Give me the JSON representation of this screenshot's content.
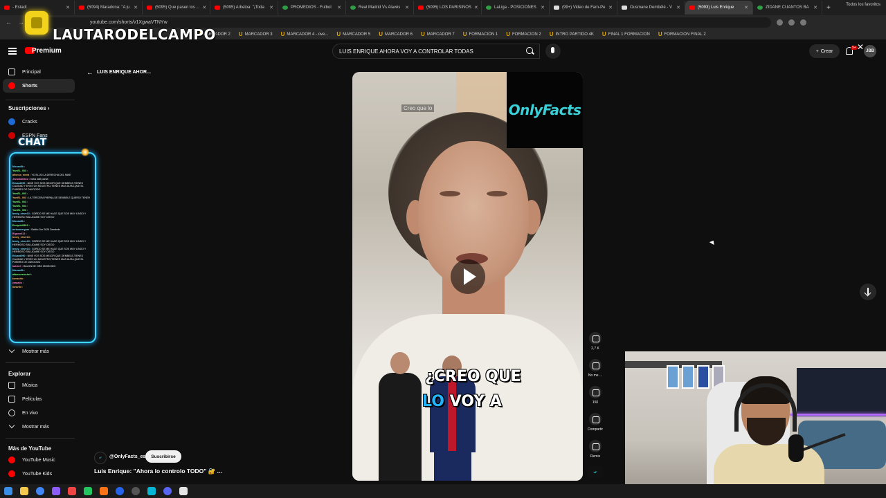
{
  "browser": {
    "tabs": [
      {
        "label": "- Estadí",
        "icon": "youtube-icon"
      },
      {
        "label": "(5094) Maradona: \"A ju",
        "icon": "youtube-icon"
      },
      {
        "label": "(5095) Que pasen los ...",
        "icon": "youtube-icon"
      },
      {
        "label": "(5095) Arbeloa: \"¡Toda",
        "icon": "youtube-icon"
      },
      {
        "label": "PROMEDIOS - Futbol",
        "icon": "green-icon"
      },
      {
        "label": "Real Madrid Vs Alavés",
        "icon": "green-icon"
      },
      {
        "label": "(5095) LOS PARISINOS",
        "icon": "youtube-icon"
      },
      {
        "label": "LaLiga - POSICIONES",
        "icon": "green-icon"
      },
      {
        "label": "(99+) Video de Fam-Pe",
        "icon": "tiktok-icon"
      },
      {
        "label": "Ousmane Dembélé - V",
        "icon": "wiki-icon"
      },
      {
        "label": "(5093) Luis Enrique",
        "icon": "youtube-icon",
        "active": true
      },
      {
        "label": "ZIDANE CUANTOS BA",
        "icon": "green-icon"
      }
    ],
    "url": "youtube.com/shorts/v1XgwaVTNYw",
    "bookmarks": [
      "MARCADOR 2",
      "MARCADOR 3",
      "MARCADOR 4 - ove...",
      "MARCADOR 5",
      "MARCADOR 6",
      "MARCADOR 7",
      "FORMACION 1",
      "FORMACION 2",
      "INTRO PARTIDO 4K",
      "FINAL 1 FORMACION",
      "FORMACION FINAL 2"
    ],
    "bookmarks_all": "Todos los favoritos"
  },
  "overlay": {
    "streamer_name": "LAUTARODELCAMPO",
    "chat_label": "CHAT",
    "chat": [
      {
        "user": "Nicoso5k :",
        "msg": "",
        "c": ""
      },
      {
        "user": "YamEL_003 :",
        "msg": "",
        "c": "g"
      },
      {
        "user": "alfonso_mvvb :",
        "msg": "YO ELIJO LA DERECHA DEL NINE",
        "c": "o"
      },
      {
        "user": "Jezuskariano :",
        "msg": "haha wait parria",
        "c": "p"
      },
      {
        "user": "Eduard090 :",
        "msg": "NINE VOS SOS MEJOR QUE DEMBELE,TIENES CALIDAD Y ERES UN MOUSTRO,TIENES MAS AURA,QUE EL PUEBRO DE DAVOODO",
        "c": ""
      },
      {
        "user": "YamEL_003 :",
        "msg": "",
        "c": "g"
      },
      {
        "user": "YamEL_003 :",
        "msg": "LA TERCERA PIERNA DE DEMBELE QUIERO TENER",
        "c": "o"
      },
      {
        "user": "YamEL_003 :",
        "msg": "",
        "c": "g"
      },
      {
        "user": "YamEL_003 :",
        "msg": "",
        "c": "g"
      },
      {
        "user": "YamEL_003 :",
        "msg": "",
        "c": "g"
      },
      {
        "user": "beuty_nieve13 :",
        "msg": "GORDO SE ME HACE QUE SOS MUY LINDO Y HERMOSO SALUDAME SOY CIEGO",
        "c": ""
      },
      {
        "user": "Nicoso5k :",
        "msg": "",
        "c": ""
      },
      {
        "user": "Ezequiel0810 :",
        "msg": "",
        "c": "g"
      },
      {
        "user": "mrbooneryyer :",
        "msg": "Ballón Dor 2026 Dembele",
        "c": ""
      },
      {
        "user": "Bigooo412 :",
        "msg": "",
        "c": "p"
      },
      {
        "user": "beuty_nieve13 :",
        "msg": "",
        "c": "o"
      },
      {
        "user": "beuty_nieve13 :",
        "msg": "GORDO SE ME HACE QUE SOS MUY LINDO Y HERMOSO SALUDAME SOY CIEGO",
        "c": ""
      },
      {
        "user": "beuty_nieve13 :",
        "msg": "GORDO SE ME HACE QUE SOS MUY LINDO Y HERMOSO SALUDAME SOY CIEGO",
        "c": ""
      },
      {
        "user": "Eduard090 :",
        "msg": "NINE VOS SOS MEJOR QUE DEMBELE,TIENES CALIDAD Y ERES UN MOUSTRO,TIENES MAS AURA,QUE EL PUEBRO DE DAVOODO",
        "c": ""
      },
      {
        "user": "kalvinX :",
        "msg": "BALON DE ORO MOISCIDO",
        "c": "p"
      },
      {
        "user": "Nicoso5k :",
        "msg": "",
        "c": ""
      },
      {
        "user": "albanoesmchef :",
        "msg": "",
        "c": "g"
      },
      {
        "user": "tomacito :",
        "msg": "",
        "c": "o"
      },
      {
        "user": "zarpado :",
        "msg": "",
        "c": "p"
      },
      {
        "user": "lunardo :",
        "msg": "",
        "c": "o"
      }
    ]
  },
  "header": {
    "brand": "Premium",
    "search_value": "LUIS ENRIQUE AHORA VOY A CONTROLAR TODAS",
    "create_label": "Crear",
    "notif_badge": "9+",
    "avatar_initials": "JBB"
  },
  "sidebar": {
    "main": [
      {
        "label": "Principal",
        "icon": "home-icon"
      },
      {
        "label": "Shorts",
        "icon": "shorts-icon",
        "active": true
      }
    ],
    "subs_title": "Suscripciones",
    "subs": [
      {
        "label": "Cracks",
        "icon": "channel-avatar-icon"
      },
      {
        "label": "ESPN Fans",
        "icon": "channel-avatar-icon"
      }
    ],
    "more_subs": "Mostrar más",
    "explore_title": "Explorar",
    "explore": [
      {
        "label": "Música",
        "icon": "music-icon"
      },
      {
        "label": "Películas",
        "icon": "film-icon"
      },
      {
        "label": "En vivo",
        "icon": "live-icon"
      }
    ],
    "more_explore": "Mostrar más",
    "more_yt_title": "Más de YouTube",
    "more_yt": [
      {
        "label": "YouTube Music",
        "icon": "youtube-music-icon"
      },
      {
        "label": "YouTube Kids",
        "icon": "youtube-kids-icon"
      }
    ]
  },
  "short": {
    "back_title": "LUIS ENRIQUE AHOR...",
    "caption_chip": "Creo que lo",
    "watermark": "OnlyFacts",
    "subtitle_line1": "¿CREO QUE",
    "subtitle_line2_hl": "LO",
    "subtitle_line2_rest": " VOY A",
    "channel": "@OnlyFacts_es",
    "subscribe_label": "Suscribirse",
    "title": "Luis Enrique: \"Ahora lo controlo TODO\" 🔐 ..."
  },
  "actions": [
    {
      "label": "2,7 K",
      "icon": "like-icon"
    },
    {
      "label": "No me ...",
      "icon": "dislike-icon"
    },
    {
      "label": "150",
      "icon": "comment-icon"
    },
    {
      "label": "Compartir",
      "icon": "share-icon"
    },
    {
      "label": "Remix",
      "icon": "remix-icon"
    }
  ],
  "colors": {
    "accent_red": "#ff0000",
    "chat_border": "#3fd7ff",
    "subtitle_highlight": "#21b5ff",
    "watermark": "#3ad0d8"
  }
}
